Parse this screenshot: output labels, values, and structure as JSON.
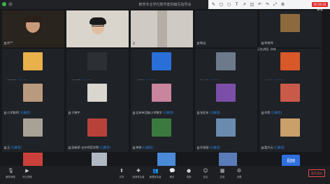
{
  "title": "教育专业学位数学案例编写指导会",
  "annotation_tools": [
    "pencil-icon",
    "rect-icon",
    "circle-icon",
    "text-icon",
    "arrow-icon",
    "eraser-icon",
    "undo-icon",
    "redo-icon",
    "fullscreen-icon",
    "settings-icon"
  ],
  "recording": "00:00:04 取消",
  "speaking": "正在讲话: 许林",
  "tiles": [
    {
      "name": "刘**",
      "role": "",
      "thumb": "#9a7b5e"
    },
    {
      "name": "",
      "role": "",
      "thumb": "#d9d4cc"
    },
    {
      "name": "黄婷",
      "role": "",
      "thumb": "#cfcac3"
    },
    {
      "name": "杨云",
      "role": "",
      "thumb": "#3a3c40"
    },
    {
      "name": "李老师",
      "role": "",
      "thumb": "#8c6a3e"
    },
    {
      "name": "王玉亮",
      "role": "(已静音)",
      "thumb": "#e8b14a"
    },
    {
      "name": "门程荣",
      "role": "(已静音)",
      "thumb": "#2c2f34"
    },
    {
      "name": "李温明",
      "role": "(已静音)",
      "thumb": "#2a6fd8"
    },
    {
      "name": "谢达静",
      "role": "(已静音)",
      "thumb": "#6c7a8c"
    },
    {
      "name": "钱松琳",
      "role": "(已静音)",
      "thumb": "#d8582a"
    },
    {
      "name": "小学数师",
      "role": "(已静音)",
      "thumb": "#b89a7e"
    },
    {
      "name": "于晓宇",
      "role": "",
      "thumb": "#d9d6d0"
    },
    {
      "name": "吉林市回族小学数学",
      "role": "(已静音)",
      "thumb": "#c9849e"
    },
    {
      "name": "张亚东",
      "role": "(已静音)",
      "thumb": "#7b4ea8"
    },
    {
      "name": "刘莉",
      "role": "(已静音)",
      "thumb": "#c95a4a"
    },
    {
      "name": "王",
      "role": "(已静音)",
      "thumb": "#a8a196"
    },
    {
      "name": "吴新娇-吉外师范学院",
      "role": "(已静音)",
      "thumb": "#b8423a"
    },
    {
      "name": "李婷",
      "role": "(已静音)",
      "thumb": "#3a7a3e"
    },
    {
      "name": "孙丽丽",
      "role": "(已静音)",
      "thumb": "#6a8ab0"
    },
    {
      "name": "富大元",
      "role": "(已静音)",
      "thumb": "#c9a06a"
    }
  ],
  "bottom_toolbar": [
    {
      "label": "解除静音",
      "icon": "mic-off-icon"
    },
    {
      "label": "停止视频",
      "icon": "camera-icon"
    },
    {
      "label": "共享",
      "icon": "share-icon"
    },
    {
      "label": "邀请参会者",
      "icon": "add-user-icon"
    },
    {
      "label": "管理参会者",
      "icon": "users-icon"
    },
    {
      "label": "聊天",
      "icon": "chat-icon"
    },
    {
      "label": "录制",
      "icon": "record-icon"
    },
    {
      "label": "反应",
      "icon": "smile-icon"
    },
    {
      "label": "应用",
      "icon": "apps-icon"
    },
    {
      "label": "设置",
      "icon": "gear-icon"
    }
  ],
  "end_button": "离开会议",
  "video_badge": "视频",
  "colors": {
    "accent": "#2f6fe0",
    "danger": "#e02b2b"
  }
}
